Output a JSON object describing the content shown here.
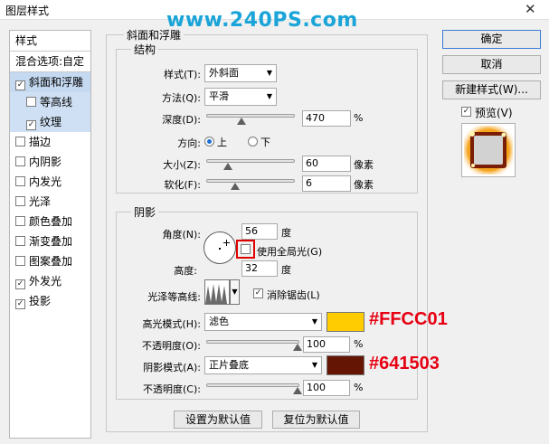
{
  "window": {
    "title": "图层样式",
    "close_glyph": "✕"
  },
  "watermark": "www.240PS.com",
  "sidebar": {
    "items": [
      {
        "label": "样式",
        "checkbox": false,
        "checked": false
      },
      {
        "label": "混合选项:自定",
        "checkbox": false,
        "checked": false
      },
      {
        "label": "斜面和浮雕",
        "checkbox": true,
        "checked": true
      },
      {
        "label": "等高线",
        "checkbox": true,
        "checked": false
      },
      {
        "label": "纹理",
        "checkbox": true,
        "checked": true
      },
      {
        "label": "描边",
        "checkbox": true,
        "checked": false
      },
      {
        "label": "内阴影",
        "checkbox": true,
        "checked": false
      },
      {
        "label": "内发光",
        "checkbox": true,
        "checked": false
      },
      {
        "label": "光泽",
        "checkbox": true,
        "checked": false
      },
      {
        "label": "颜色叠加",
        "checkbox": true,
        "checked": false
      },
      {
        "label": "渐变叠加",
        "checkbox": true,
        "checked": false
      },
      {
        "label": "图案叠加",
        "checkbox": true,
        "checked": false
      },
      {
        "label": "外发光",
        "checkbox": true,
        "checked": true
      },
      {
        "label": "投影",
        "checkbox": true,
        "checked": true
      }
    ]
  },
  "bevel": {
    "group_title": "斜面和浮雕",
    "structure_title": "结构",
    "style_label": "样式(T):",
    "style_value": "外斜面",
    "technique_label": "方法(Q):",
    "technique_value": "平滑",
    "depth_label": "深度(D):",
    "depth_value": "470",
    "depth_unit": "%",
    "depth_slider": 0.4,
    "direction_label": "方向:",
    "dir_up": "上",
    "dir_down": "下",
    "size_label": "大小(Z):",
    "size_value": "60",
    "size_unit": "像素",
    "size_slider": 0.24,
    "soften_label": "软化(F):",
    "soften_value": "6",
    "soften_unit": "像素",
    "soften_slider": 0.33
  },
  "shading": {
    "group_title": "阴影",
    "angle_label": "角度(N):",
    "angle_value": "56",
    "angle_unit": "度",
    "global_light_label": "使用全局光(G)",
    "altitude_label": "高度:",
    "altitude_value": "32",
    "altitude_unit": "度",
    "gloss_label": "光泽等高线:",
    "antialias_label": "消除锯齿(L)",
    "highlight_mode_label": "高光模式(H):",
    "highlight_mode_value": "滤色",
    "highlight_color": "#FFCC01",
    "highlight_hex_label": "#FFCC01",
    "highlight_opacity_label": "不透明度(O):",
    "highlight_opacity_value": "100",
    "highlight_opacity_unit": "%",
    "shadow_mode_label": "阴影模式(A):",
    "shadow_mode_value": "正片叠底",
    "shadow_color": "#641503",
    "shadow_hex_label": "#641503",
    "shadow_opacity_label": "不透明度(C):",
    "shadow_opacity_value": "100",
    "shadow_opacity_unit": "%"
  },
  "buttons": {
    "make_default": "设置为默认值",
    "reset_default": "复位为默认值",
    "ok": "确定",
    "cancel": "取消",
    "new_style": "新建样式(W)...",
    "preview": "预览(V)"
  }
}
